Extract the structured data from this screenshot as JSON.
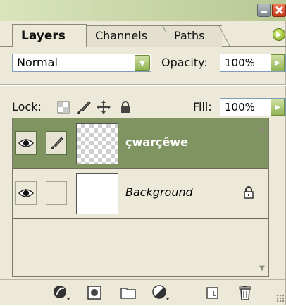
{
  "tabs": [
    {
      "label": "Layers"
    },
    {
      "label": "Channels"
    },
    {
      "label": "Paths"
    }
  ],
  "blend": {
    "mode": "Normal"
  },
  "opacity": {
    "label": "Opacity:",
    "value": "100%"
  },
  "lock": {
    "label": "Lock:"
  },
  "fill": {
    "label": "Fill:",
    "value": "100%"
  },
  "layers": [
    {
      "name": "çwarçêwe",
      "selected": true,
      "visible": true,
      "thumbnail": "transparent-checker"
    },
    {
      "name": "Background",
      "selected": false,
      "visible": true,
      "locked": true,
      "thumbnail": "white"
    }
  ],
  "icons": {
    "title": [
      "minimize-icon",
      "close-icon"
    ],
    "lock": [
      "lock-transparent-pixels-icon",
      "lock-image-pixels-icon",
      "lock-position-icon",
      "lock-all-icon"
    ],
    "toolbar": [
      "layer-style-icon",
      "layer-mask-icon",
      "new-group-icon",
      "adjustment-layer-icon",
      "new-layer-icon",
      "delete-layer-icon"
    ]
  },
  "colors": {
    "panel_bg": "#ece9d8",
    "selected_row": "#7f9460",
    "accent_green": "#93b456"
  }
}
